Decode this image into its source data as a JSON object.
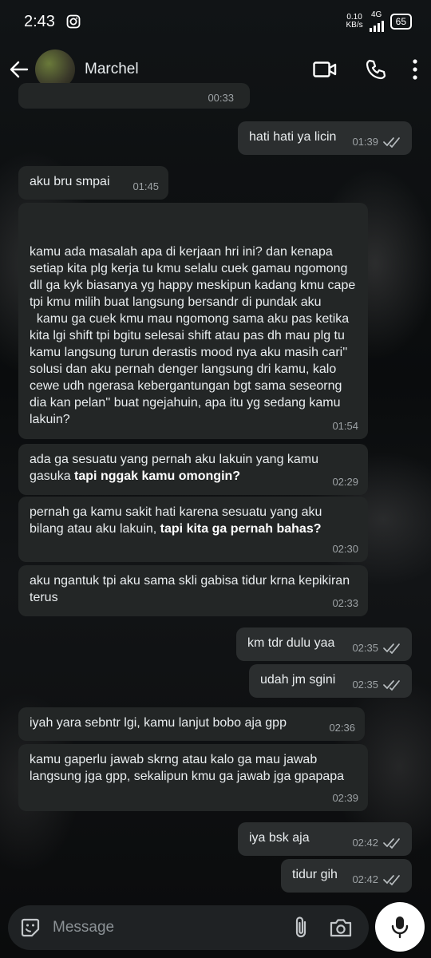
{
  "status": {
    "time": "2:43",
    "net_speed_value": "0.10",
    "net_speed_unit": "KB/s",
    "network": "4G",
    "battery": "65"
  },
  "header": {
    "contact_name": "Marchel"
  },
  "partial_top": {
    "time": "00:33"
  },
  "messages": [
    {
      "dir": "out",
      "text": "hati hati ya licin",
      "time": "01:39",
      "read": true
    },
    {
      "dir": "in",
      "text": "aku bru smpai",
      "time": "01:45"
    },
    {
      "dir": "in",
      "text": "kamu ada masalah apa di kerjaan hri ini? dan kenapa setiap kita plg kerja tu kmu selalu cuek gamau ngomong dll ga kyk biasanya yg happy meskipun kadang kmu cape tpi kmu milih buat langsung bersandr di pundak aku\n  kamu ga cuek kmu mau ngomong sama aku pas ketika kita lgi shift tpi bgitu selesai shift atau pas dh mau plg tu kamu langsung turun derastis mood nya aku masih cari'' solusi dan aku pernah denger langsung dri kamu, kalo cewe udh ngerasa kebergantungan bgt sama seseorng dia kan pelan'' buat ngejahuin, apa itu yg sedang kamu lakuin?",
      "time": "01:54"
    },
    {
      "dir": "in",
      "text_plain": "ada ga sesuatu yang pernah aku lakuin yang kamu gasuka ",
      "text_bold": "tapi nggak kamu omongin?",
      "time": "02:29"
    },
    {
      "dir": "in",
      "text_plain": "pernah ga kamu sakit hati karena sesuatu yang aku bilang atau aku lakuin, ",
      "text_bold": "tapi kita ga pernah bahas?",
      "time": "02:30"
    },
    {
      "dir": "in",
      "text": "aku ngantuk tpi aku sama skli gabisa tidur krna kepikiran terus",
      "time": "02:33"
    },
    {
      "dir": "out",
      "text": "km tdr dulu yaa",
      "time": "02:35",
      "read": true
    },
    {
      "dir": "out",
      "text": "udah jm sgini",
      "time": "02:35",
      "read": true
    },
    {
      "dir": "in",
      "text": "iyah yara sebntr lgi, kamu lanjut bobo aja gpp",
      "time": "02:36"
    },
    {
      "dir": "in",
      "text": "kamu gaperlu jawab skrng atau kalo ga mau jawab langsung jga gpp, sekalipun kmu ga jawab jga gpapapa",
      "time": "02:39"
    },
    {
      "dir": "out",
      "text": "iya bsk aja",
      "time": "02:42",
      "read": true
    },
    {
      "dir": "out",
      "text": "tidur gih",
      "time": "02:42",
      "read": true
    }
  ],
  "compose": {
    "placeholder": "Message"
  },
  "icons": [
    "instagram-icon",
    "signal-icon",
    "back-arrow-icon",
    "video-call-icon",
    "phone-call-icon",
    "more-options-icon",
    "sticker-icon",
    "attach-icon",
    "camera-icon",
    "mic-icon",
    "double-check-icon"
  ],
  "colors": {
    "bubble_in": "#232626",
    "bubble_out": "#2b2e2f",
    "meta_text": "#9ea3a6",
    "mic_button": "#ffffff"
  }
}
